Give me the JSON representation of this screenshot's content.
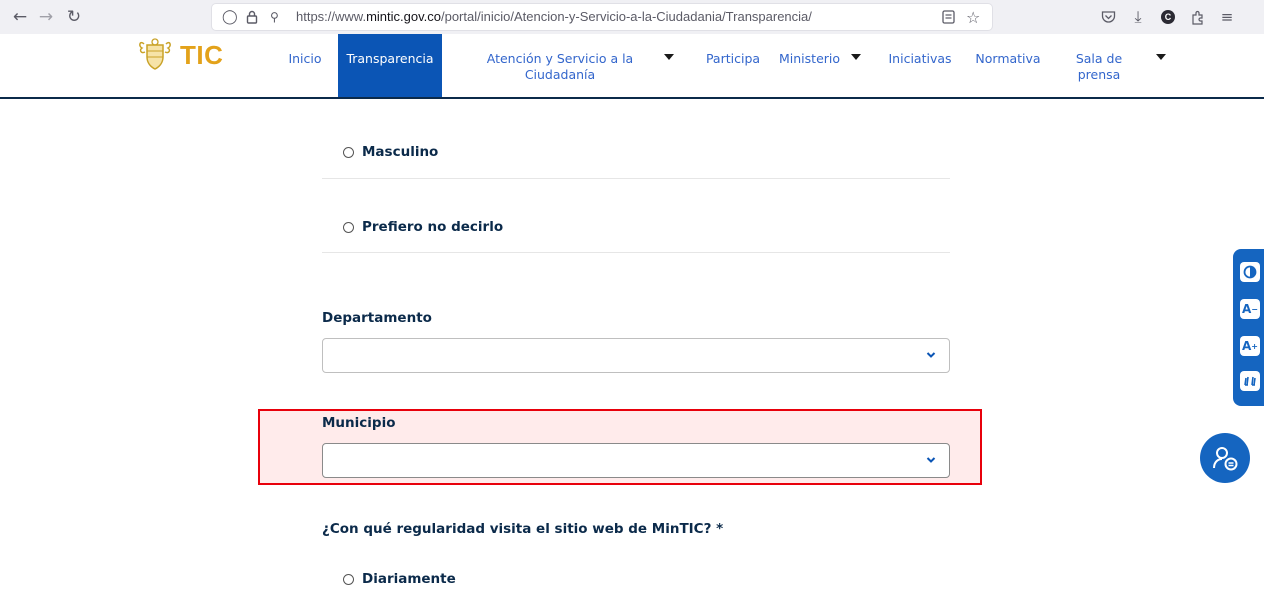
{
  "browser": {
    "url_prefix": "https://www.",
    "url_domain": "mintic.gov.co",
    "url_path": "/portal/inicio/Atencion-y-Servicio-a-la-Ciudadania/Transparencia/",
    "profile_initial": "C"
  },
  "header": {
    "logo_text": "TIC",
    "nav": [
      {
        "label": "Inicio"
      },
      {
        "label": "Transparencia",
        "active": true
      },
      {
        "label": "Atención y Servicio a la Ciudadanía",
        "dropdown": true
      },
      {
        "label": "Participa"
      },
      {
        "label": "Ministerio",
        "dropdown": true
      },
      {
        "label": "Iniciativas"
      },
      {
        "label": "Normativa"
      },
      {
        "label": "Sala de prensa",
        "dropdown": true
      }
    ]
  },
  "form": {
    "gender_options": [
      "Masculino",
      "Prefiero no decirlo"
    ],
    "departamento": {
      "label": "Departamento",
      "value": ""
    },
    "municipio": {
      "label": "Municipio",
      "value": ""
    },
    "frequency_question": "¿Con qué regularidad visita el sitio web de MinTIC? *",
    "frequency_options": [
      "Diariamente"
    ]
  },
  "accessibility": {
    "buttons": [
      "contrast-icon",
      "decrease-font-icon",
      "increase-font-icon",
      "sign-language-icon"
    ],
    "labels": [
      "A",
      "A"
    ]
  },
  "colors": {
    "brand_blue": "#0b55b5",
    "text_navy": "#0b2a4a",
    "link_blue": "#3366cc",
    "highlight_red": "#e8000b",
    "logo_gold": "#e3a21a"
  }
}
